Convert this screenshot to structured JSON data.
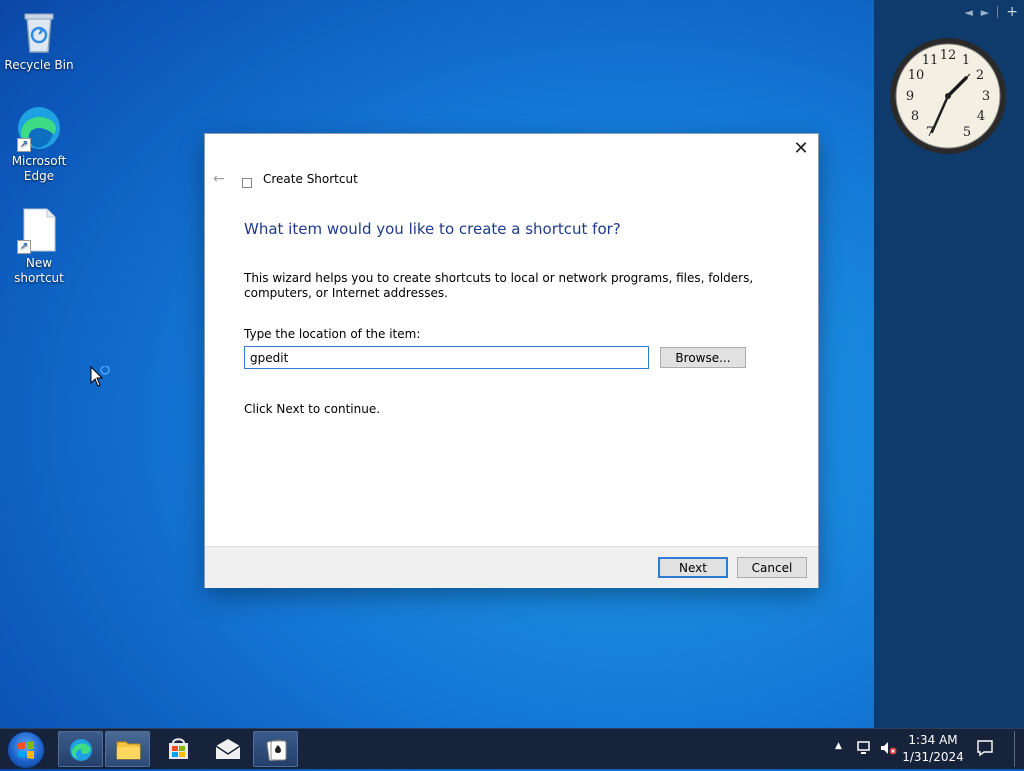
{
  "desktop": {
    "icons": [
      {
        "label": "Recycle Bin"
      },
      {
        "label": "Microsoft Edge"
      },
      {
        "label": "New shortcut"
      }
    ]
  },
  "sidebar": {
    "controls": {
      "prev": "◄",
      "next": "►",
      "add": "+"
    },
    "clock_numbers": [
      "12",
      "1",
      "2",
      "3",
      "4",
      "5",
      "7",
      "8",
      "9",
      "10",
      "11"
    ]
  },
  "dialog": {
    "close_label": "✕",
    "back_label": "←",
    "title": "Create Shortcut",
    "heading": "What item would you like to create a shortcut for?",
    "description": "This wizard helps you to create shortcuts to local or network programs, files, folders, computers, or Internet addresses.",
    "location_label": "Type the location of the item:",
    "location_value": "gpedit",
    "browse_label": "Browse...",
    "continue_text": "Click Next to continue.",
    "next_label": "Next",
    "cancel_label": "Cancel"
  },
  "taskbar": {
    "time": "1:34 AM",
    "date": "1/31/2024",
    "tray_up": "▲"
  },
  "colors": {
    "heading": "#1e3a8a",
    "focus": "#2f7bd3",
    "taskbar": "#16233a",
    "sidebar": "#0e3a6c"
  }
}
